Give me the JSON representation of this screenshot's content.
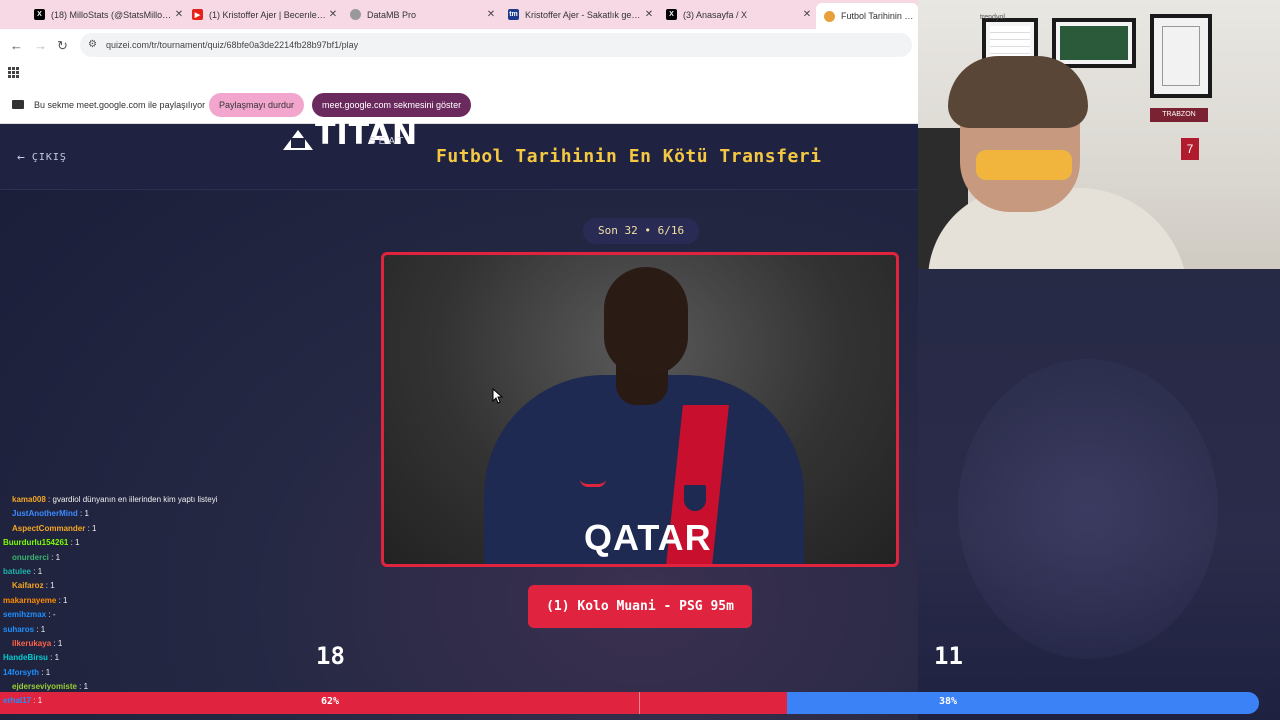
{
  "browser": {
    "tabs": [
      {
        "label": "(18) MilloStats (@StatsMillo) / X",
        "icon": "x-logo-icon",
        "icon_color": "#000000"
      },
      {
        "label": "(1) Kristoffer Ajer | Becerıler ve Hed",
        "icon": "youtube-icon",
        "icon_color": "#e62117"
      },
      {
        "label": "DataMB Pro",
        "icon": "globe-icon",
        "icon_color": "#888888"
      },
      {
        "label": "Kristoffer Ajer - Sakatlık geçmişi",
        "icon": "transfermarkt-icon",
        "icon_color": "#1d3a8a"
      },
      {
        "label": "(3) Anasayfa / X",
        "icon": "x-logo-icon",
        "icon_color": "#000000"
      },
      {
        "label": "Futbol Tarihinin En Kötü",
        "icon": "quizei-icon",
        "icon_color": "#e8a13a"
      }
    ],
    "url": "quizei.com/tr/tournament/quiz/68bfe0a3de2214fb28b97bf1/play"
  },
  "share": {
    "text": "Bu sekme meet.google.com ile paylaşılıyor",
    "stop_label": "Paylaşmayı durdur",
    "show_label": "meet.google.com sekmesini göster"
  },
  "page": {
    "back_label": "ÇIKIŞ",
    "logo_text": "TITAN",
    "logo_sub": "SEAT",
    "title": "Futbol Tarihinin En Kötü Transferi",
    "round": "Son 32 • 6/16",
    "answer": "(1) Kolo Muani - PSG 95m",
    "photo_sponsor": "QATAR",
    "count_left": "18",
    "count_right": "11",
    "pct_left": "62%",
    "pct_right": "38%",
    "pct_left_value": 62,
    "colors": {
      "accent": "#f5c842",
      "red": "#e0243f",
      "blue": "#3b82f6"
    }
  },
  "chat": [
    {
      "user": "kama008",
      "msg": ": gvardiol dünyanın en iilerinden kim yaptı listeyi",
      "color": "#f5a623"
    },
    {
      "user": "JustAnotherMind",
      "msg": ": 1",
      "color": "#3b8bff"
    },
    {
      "user": "AspectCommander",
      "msg": ": 1",
      "color": "#f5a623"
    },
    {
      "user": "Buurdurlu154261",
      "msg": ": 1",
      "color": "#7cfc00"
    },
    {
      "user": "onurderci",
      "msg": ": 1",
      "color": "#3cb371"
    },
    {
      "user": "batulee",
      "msg": ": 1",
      "color": "#20b2aa"
    },
    {
      "user": "Kaifaroz",
      "msg": ": 1",
      "color": "#f5a623"
    },
    {
      "user": "makarnayeme",
      "msg": ": 1",
      "color": "#ff8c00"
    },
    {
      "user": "semihzmax",
      "msg": ": -",
      "color": "#1e90ff"
    },
    {
      "user": "suharos",
      "msg": ": 1",
      "color": "#1e90ff"
    },
    {
      "user": "ilkerukaya",
      "msg": ": 1",
      "color": "#ff6347"
    },
    {
      "user": "HandeBirsu",
      "msg": ": 1",
      "color": "#00ced1"
    },
    {
      "user": "14forsyth",
      "msg": ": 1",
      "color": "#1e90ff"
    },
    {
      "user": "ejderseviyomiste",
      "msg": ": 1",
      "color": "#9acd32"
    },
    {
      "user": "erhal17",
      "msg": ": 1",
      "color": "#1e90ff"
    }
  ],
  "webcam": {
    "trabzon": "TRABZON",
    "red_card": "7",
    "wall_sign": "trendyol"
  }
}
